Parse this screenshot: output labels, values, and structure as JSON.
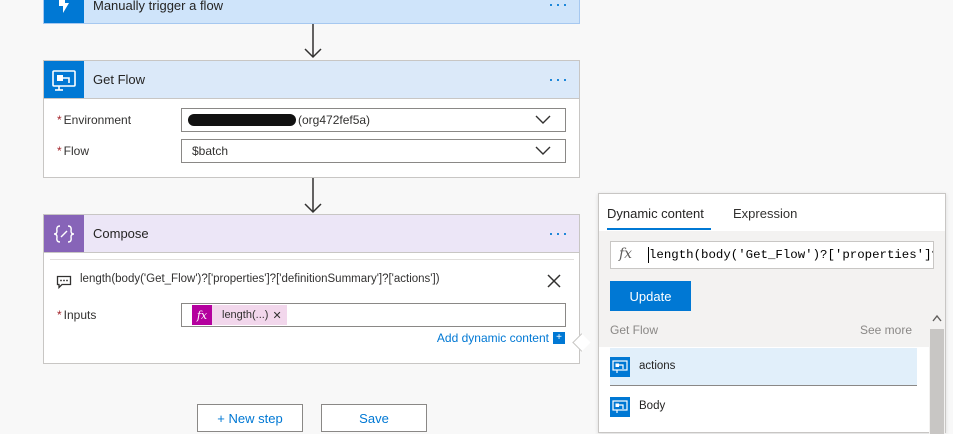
{
  "trigger": {
    "title": "Manually trigger a flow",
    "color": "#0078d4"
  },
  "get_flow": {
    "title": "Get Flow",
    "color": "#0078d4",
    "environment": {
      "label": "Environment",
      "value": "(org472fef5a)"
    },
    "flow": {
      "label": "Flow",
      "value": "$batch"
    }
  },
  "compose": {
    "title": "Compose",
    "color": "#8764b8",
    "expression": "length(body('Get_Flow')?['properties']?['definitionSummary']?['actions'])",
    "inputs_label": "Inputs",
    "token_label": "length(...)",
    "add_dynamic": "Add dynamic content"
  },
  "actions": {
    "new_step": "+ New step",
    "save": "Save"
  },
  "dynamic_panel": {
    "tabs": [
      "Dynamic content",
      "Expression"
    ],
    "active_tab": "Dynamic content",
    "fx_symbol": "fx",
    "expression_text": "length(body('Get_Flow')?['properties']?['",
    "update_label": "Update",
    "section_title": "Get Flow",
    "see_more": "See more",
    "items": [
      "actions",
      "Body"
    ]
  },
  "icons": [
    "lightning-trigger-icon",
    "flow-icon",
    "compose-braces-icon",
    "comment-icon",
    "close-icon",
    "chevron-down-icon",
    "fx-icon",
    "scroll-up-icon"
  ]
}
